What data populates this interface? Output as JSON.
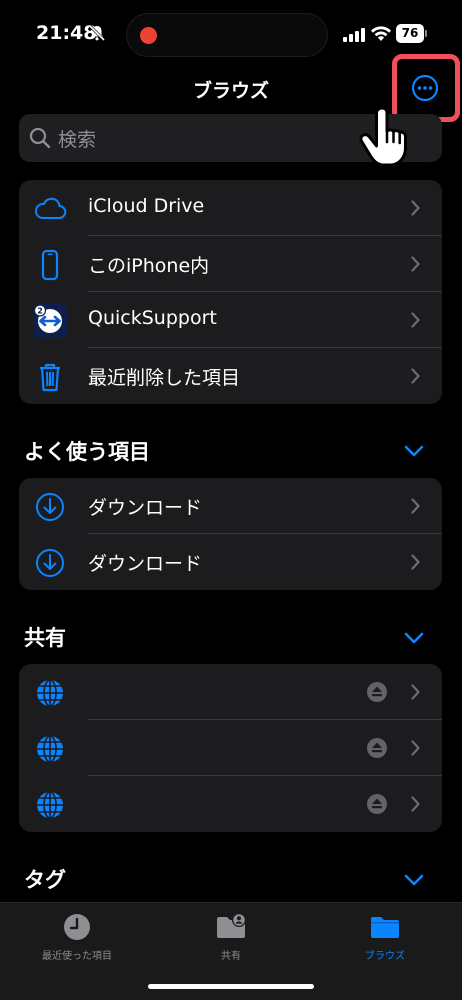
{
  "status_bar": {
    "time": "21:48",
    "battery": "76"
  },
  "nav": {
    "title": "ブラウズ"
  },
  "search": {
    "placeholder": "検索"
  },
  "locations": [
    {
      "label": "iCloud Drive",
      "icon": "cloud-icon"
    },
    {
      "label": "このiPhone内",
      "icon": "iphone-icon"
    },
    {
      "label": "QuickSupport",
      "icon": "quicksupport-app-icon"
    },
    {
      "label": "最近削除した項目",
      "icon": "trash-icon"
    }
  ],
  "favorites": {
    "title": "よく使う項目",
    "items": [
      {
        "label": "ダウンロード",
        "icon": "download-icon"
      },
      {
        "label": "ダウンロード",
        "icon": "download-icon"
      }
    ]
  },
  "shared": {
    "title": "共有",
    "items": [
      {
        "label": "",
        "icon": "network-globe-icon"
      },
      {
        "label": "",
        "icon": "network-globe-icon"
      },
      {
        "label": "",
        "icon": "network-globe-icon"
      }
    ]
  },
  "tags": {
    "title": "タグ"
  },
  "tab_bar": {
    "tabs": [
      {
        "label": "最近使った項目",
        "icon": "clock-icon",
        "active": false
      },
      {
        "label": "共有",
        "icon": "shared-folder-icon",
        "active": false
      },
      {
        "label": "ブラウズ",
        "icon": "folder-icon",
        "active": true
      }
    ]
  },
  "colors": {
    "accent": "#0a84ff",
    "highlight": "#f0505a",
    "card": "#1c1c1e"
  }
}
